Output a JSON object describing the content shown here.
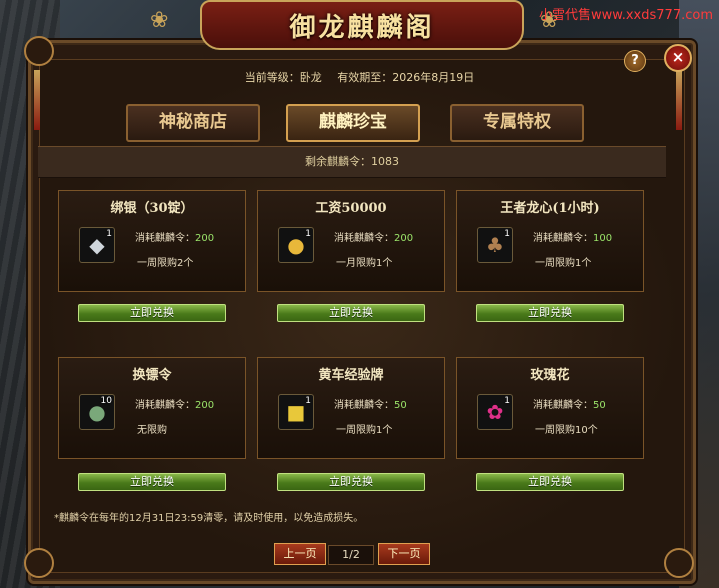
{
  "watermark": "小雪代售www.xxds777.com",
  "title": "御龙麒麟阁",
  "header": {
    "level_label": "当前等级：卧龙",
    "expire_label": "有效期至：2026年8月19日"
  },
  "tabs": [
    {
      "label": "神秘商店",
      "active": false
    },
    {
      "label": "麒麟珍宝",
      "active": true
    },
    {
      "label": "专属特权",
      "active": false
    }
  ],
  "remain_text": "剩余麒麟令：1083",
  "cost_prefix": "消耗麒麟令：",
  "exchange_label": "立即兑换",
  "items": [
    {
      "name": "绑银（30锭）",
      "icon": "silver-ingot-icon",
      "qty": "1",
      "cost": "200",
      "limit": "一周限购2个"
    },
    {
      "name": "工资50000",
      "icon": "gold-coins-icon",
      "qty": "1",
      "cost": "200",
      "limit": "一月限购1个"
    },
    {
      "name": "王者龙心(1小时)",
      "icon": "dragon-heart-icon",
      "qty": "1",
      "cost": "100",
      "limit": "一周限购1个"
    },
    {
      "name": "换镖令",
      "icon": "escort-token-icon",
      "qty": "10",
      "cost": "200",
      "limit": "无限购"
    },
    {
      "name": "黄车经验牌",
      "icon": "yellow-cart-icon",
      "qty": "1",
      "cost": "50",
      "limit": "一周限购1个"
    },
    {
      "name": "玫瑰花",
      "icon": "rose-icon",
      "qty": "1",
      "cost": "50",
      "limit": "一周限购10个"
    }
  ],
  "notice": "*麒麟令在每年的12月31日23:59清零，请及时使用，以免造成损失。",
  "pager": {
    "prev": "上一页",
    "page": "1/2",
    "next": "下一页"
  },
  "help_glyph": "?",
  "close_glyph": "×"
}
